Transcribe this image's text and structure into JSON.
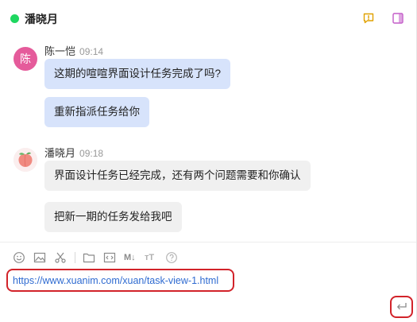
{
  "header": {
    "title": "潘晓月",
    "status_color": "#1ed760"
  },
  "messages": [
    {
      "sender": "陈一恺",
      "avatar_text": "陈",
      "time": "09:14",
      "bubbles": [
        "这期的喧喧界面设计任务完成了吗?",
        "重新指派任务给你"
      ]
    },
    {
      "sender": "潘晓月",
      "avatar_icon": "peach-avatar",
      "time": "09:18",
      "bubbles": [
        "界面设计任务已经完成，还有两个问题需要和你确认",
        "把新一期的任务发给我吧"
      ]
    }
  ],
  "toolbar": {
    "icons": [
      "emoji-icon",
      "image-icon",
      "scissors-icon",
      "folder-icon",
      "code-icon",
      "markdown-icon",
      "font-size-icon",
      "help-icon"
    ],
    "markdown_label": "M↓",
    "font_label": "ᴛT"
  },
  "input": {
    "value": "https://www.xuanim.com/xuan/task-view-1.html"
  },
  "colors": {
    "accent": "#d2232a",
    "my_bubble": "#d7e3fb",
    "their_bubble": "#f0f0f0",
    "link": "#2f6bd1",
    "icon_todo": "#e0a100",
    "icon_sidebar": "#c35bc8"
  }
}
